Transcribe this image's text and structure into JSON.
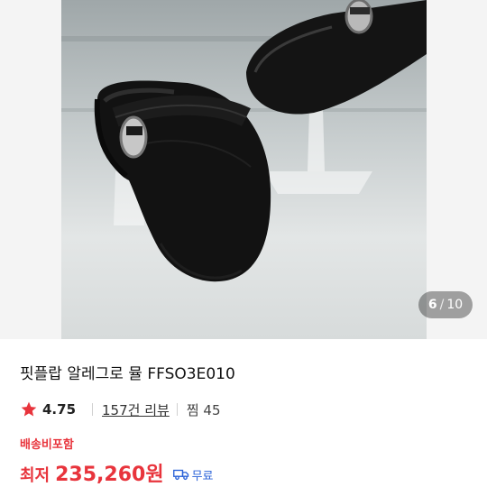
{
  "gallery": {
    "current": "6",
    "separator": "/",
    "total": "10"
  },
  "product": {
    "title": "핏플랍 알레그로 뮬 FFSO3E010",
    "rating": "4.75",
    "reviews": "157건 리뷰",
    "wishlist": "찜 45",
    "shipping_note": "배송비포함",
    "price_prefix": "최저",
    "price": "235,260원",
    "delivery": "무료"
  },
  "colors": {
    "accent": "#e8343c",
    "delivery": "#2a62d8"
  },
  "icons": {
    "rating": "star-icon",
    "delivery": "truck-icon"
  }
}
